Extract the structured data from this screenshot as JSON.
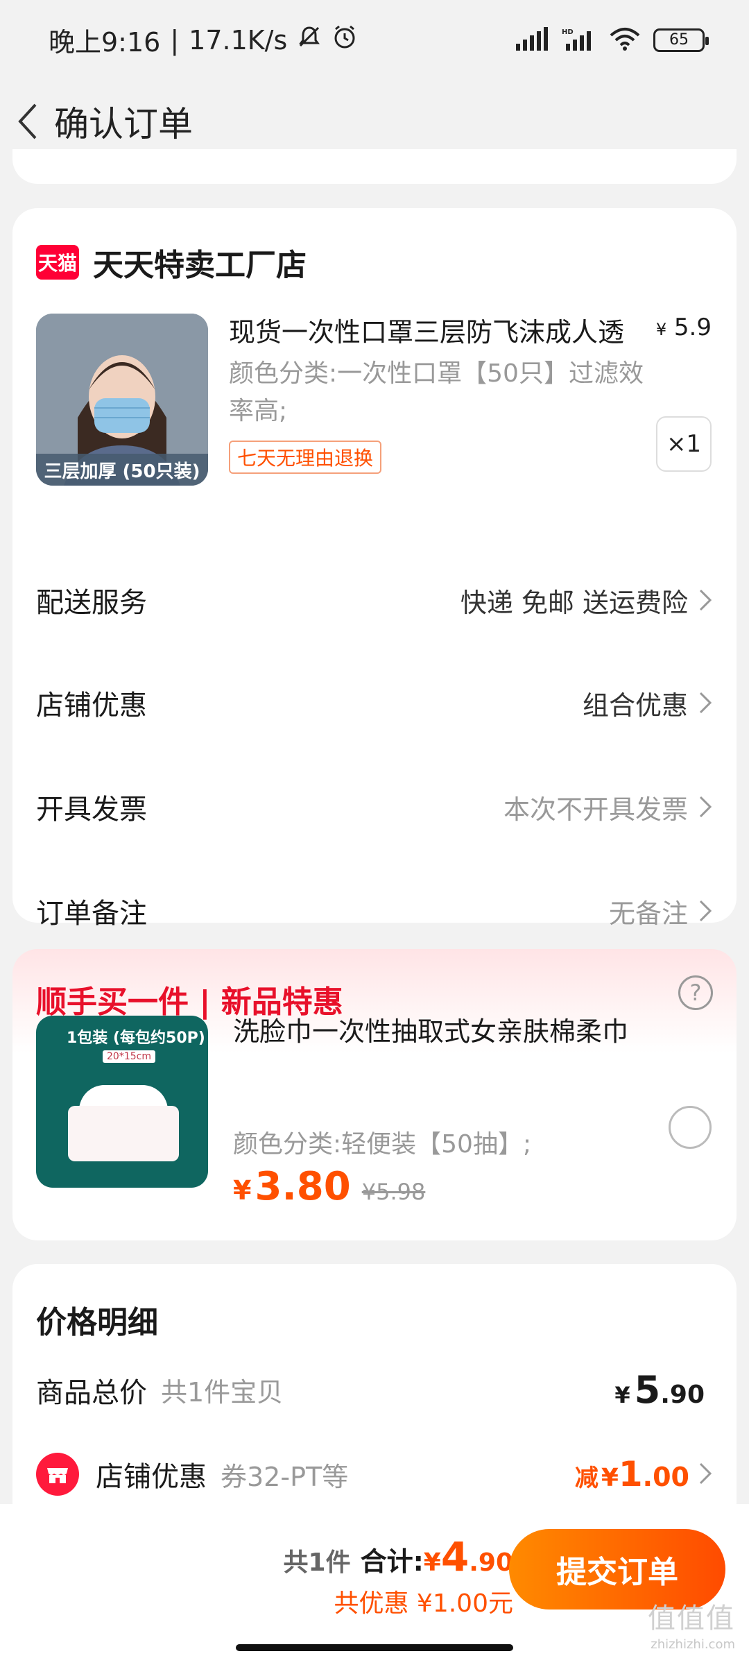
{
  "status_bar": {
    "time": "晚上9:16",
    "separator": "|",
    "net_speed": "17.1K/s",
    "battery": "65",
    "icons": [
      "mute-bell-icon",
      "alarm-icon",
      "signal-icon",
      "hd-signal-icon",
      "wifi-icon",
      "battery-icon"
    ]
  },
  "header": {
    "title": "确认订单"
  },
  "store": {
    "badge": "天猫",
    "name": "天天特卖工厂店",
    "product": {
      "title": "现货一次性口罩三层防飞沫成人透",
      "price_currency": "¥",
      "price": "5.9",
      "variant": "颜色分类:一次性口罩【50只】过滤效率高;",
      "return_badge": "七天无理由退换",
      "quantity": "×1",
      "thumb_caption": "三层加厚 (50只装)"
    },
    "rows": [
      {
        "label": "配送服务",
        "value": "快递 免邮 送运费险",
        "muted": false
      },
      {
        "label": "店铺优惠",
        "value": "组合优惠",
        "muted": false
      },
      {
        "label": "开具发票",
        "value": "本次不开具发票",
        "muted": true
      },
      {
        "label": "订单备注",
        "value": "无备注",
        "muted": true
      }
    ]
  },
  "addon": {
    "title": "顺手买一件 | 新品特惠",
    "help": "?",
    "thumb_label": "1包装 (每包约50P)",
    "thumb_size": "20*15cm",
    "name": "洗脸巾一次性抽取式女亲肤棉柔巾",
    "variant": "颜色分类:轻便装【50抽】;",
    "price_currency": "¥",
    "price": "3.80",
    "original_price": "¥5.98"
  },
  "price_detail": {
    "title": "价格明细",
    "goods_total_label": "商品总价",
    "goods_count": "共1件宝贝",
    "goods_total_currency": "¥",
    "goods_total_int": "5",
    "goods_total_dec": ".90",
    "shop_discount_label": "店铺优惠",
    "shop_discount_coupon": "券32-PT等",
    "discount_prefix": "减",
    "discount_currency": "¥",
    "discount_int": "1",
    "discount_dec": ".00"
  },
  "bottom": {
    "count": "共1件",
    "total_label": "合计:",
    "total_currency": "¥",
    "total_int": "4",
    "total_dec": ".90",
    "saved": "共优惠 ¥1.00元",
    "submit": "提交订单"
  },
  "watermark": {
    "text": "值值值",
    "sub": "zhizhizhi.com"
  },
  "colors": {
    "accent": "#ff5000",
    "tmall_red": "#ff0036",
    "addon_title": "#e8102a",
    "muted": "#999999"
  }
}
